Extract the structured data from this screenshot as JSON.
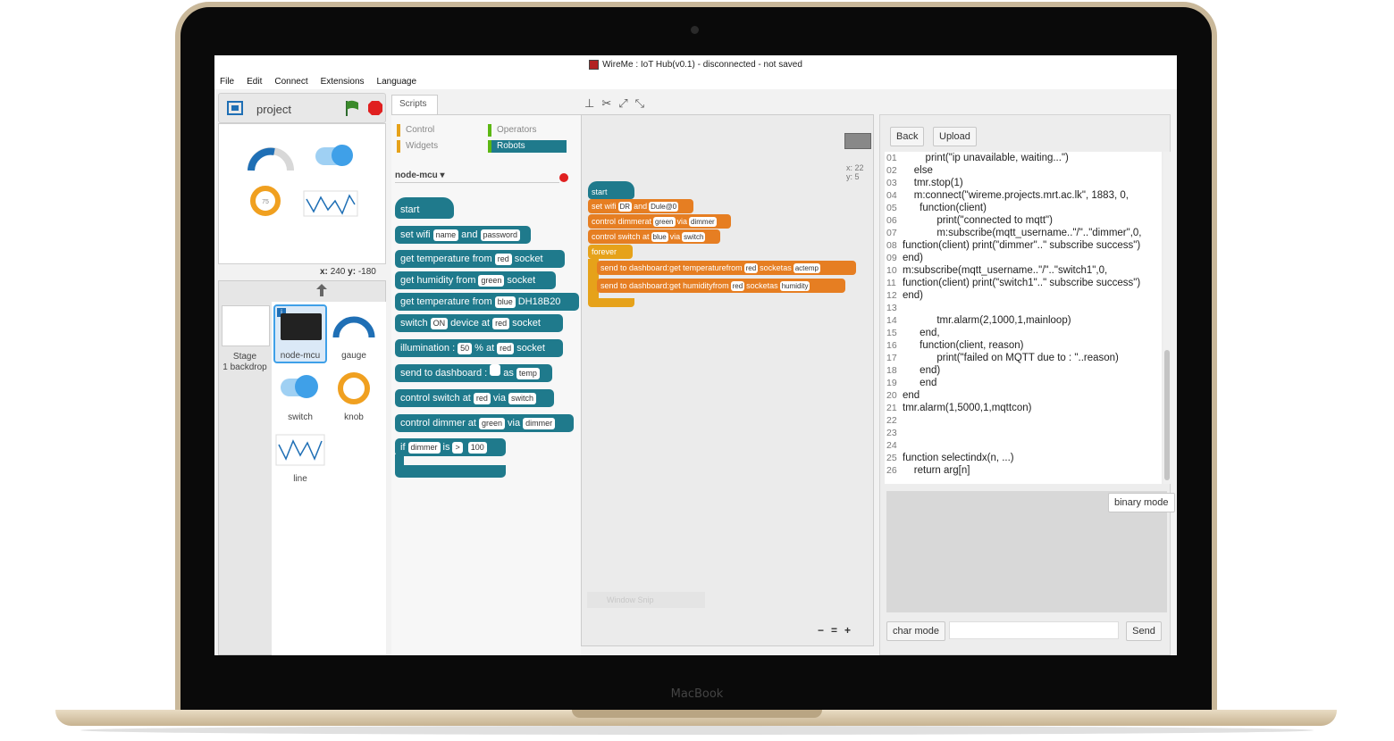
{
  "window": {
    "title": "WireMe : IoT Hub(v0.1) - disconnected - not saved"
  },
  "menu": [
    "File",
    "Edit",
    "Connect",
    "Extensions",
    "Language"
  ],
  "stage": {
    "project_label": "project",
    "coords_x_label": "x:",
    "coords_x": "240",
    "coords_y_label": "y:",
    "coords_y": "-180",
    "knob_value": "75"
  },
  "sprites": {
    "stage_label": "Stage",
    "backdrop_label": "1 backdrop",
    "items": [
      "node-mcu",
      "gauge",
      "switch",
      "knob",
      "line"
    ]
  },
  "tabs": {
    "scripts": "Scripts"
  },
  "categories": [
    "Control",
    "Operators",
    "Widgets",
    "Robots"
  ],
  "device": {
    "name": "node-mcu"
  },
  "palette": {
    "start": "start",
    "set_wifi": {
      "a": "set wifi",
      "b": "name",
      "c": "and",
      "d": "password"
    },
    "get_temp_red": {
      "a": "get temperature from",
      "b": "red",
      "c": "socket"
    },
    "get_hum_green": {
      "a": "get humidity from",
      "b": "green",
      "c": "socket"
    },
    "get_temp_blue": {
      "a": "get temperature from",
      "b": "blue",
      "c": "DH18B20"
    },
    "switch": {
      "a": "switch",
      "b": "ON",
      "c": "device at",
      "d": "red",
      "e": "socket"
    },
    "illum": {
      "a": "illumination :",
      "b": "50",
      "c": "% at",
      "d": "red",
      "e": "socket"
    },
    "send": {
      "a": "send to dashboard :",
      "b": "",
      "c": "as",
      "d": "temp"
    },
    "ctrl_switch": {
      "a": "control switch at",
      "b": "red",
      "c": "via",
      "d": "switch"
    },
    "ctrl_dimmer": {
      "a": "control dimmer at",
      "b": "green",
      "c": "via",
      "d": "dimmer"
    },
    "if": {
      "a": "if",
      "b": "dimmer",
      "c": "is",
      "d": ">",
      "e": "100"
    }
  },
  "script": {
    "coords": "x: 22\ny: 5",
    "start": "start",
    "set_wifi": {
      "a": "set wifi",
      "b": "DR",
      "c": "and",
      "d": "Dule@0"
    },
    "ctrl_dimmer": {
      "a": "control dimmerat",
      "b": "green",
      "c": "via",
      "d": "dimmer"
    },
    "ctrl_switch": {
      "a": "control switch at",
      "b": "blue",
      "c": "via",
      "d": "switch"
    },
    "forever": "forever",
    "send1": {
      "a": "send to dashboard:",
      "b": "get temperaturefrom",
      "c": "red",
      "d": "socket",
      "e": "as",
      "f": "actemp"
    },
    "send2": {
      "a": "send to dashboard:",
      "b": "get humidityfrom",
      "c": "red",
      "d": "socket",
      "e": "as",
      "f": "humidity"
    },
    "watermark": "Window Snip",
    "zoom": [
      "−",
      "=",
      "+"
    ]
  },
  "right": {
    "back": "Back",
    "upload": "Upload",
    "binary_mode": "binary mode",
    "char_mode": "char mode",
    "send": "Send",
    "input_value": ""
  },
  "code_lines": [
    [
      "01",
      "        print(\"ip unavailable, waiting...\")"
    ],
    [
      "02",
      "    else"
    ],
    [
      "03",
      "    tmr.stop(1)"
    ],
    [
      "04",
      "    m:connect(\"wireme.projects.mrt.ac.lk\", 1883, 0,"
    ],
    [
      "05",
      "      function(client)"
    ],
    [
      "06",
      "            print(\"connected to mqtt\")"
    ],
    [
      "07",
      "            m:subscribe(mqtt_username..\"/\"..\"dimmer\",0,"
    ],
    [
      "08",
      "function(client) print(\"dimmer\"..\" subscribe success\")"
    ],
    [
      "09",
      "end)"
    ],
    [
      "10",
      "m:subscribe(mqtt_username..\"/\"..\"switch1\",0,"
    ],
    [
      "11",
      "function(client) print(\"switch1\"..\" subscribe success\")"
    ],
    [
      "12",
      "end)"
    ],
    [
      "13",
      ""
    ],
    [
      "14",
      "            tmr.alarm(2,1000,1,mainloop)"
    ],
    [
      "15",
      "      end,"
    ],
    [
      "16",
      "      function(client, reason)"
    ],
    [
      "17",
      "            print(\"failed on MQTT due to : \"..reason)"
    ],
    [
      "18",
      "      end)"
    ],
    [
      "19",
      "      end"
    ],
    [
      "20",
      "end"
    ],
    [
      "21",
      "tmr.alarm(1,5000,1,mqttcon)"
    ],
    [
      "22",
      ""
    ],
    [
      "23",
      ""
    ],
    [
      "24",
      ""
    ],
    [
      "25",
      "function selectindx(n, ...)"
    ],
    [
      "26",
      "    return arg[n]"
    ]
  ],
  "colors": {
    "block_teal": "#1f7a8c",
    "block_orange": "#e67e22",
    "control": "#e6a21a",
    "operators": "#5cb713",
    "robots": "#1f7a8c",
    "gauge_blue": "#1f6fb5",
    "switch_blue": "#3fa0e8",
    "knob_orange": "#f0a020"
  },
  "brand": "MacBook"
}
